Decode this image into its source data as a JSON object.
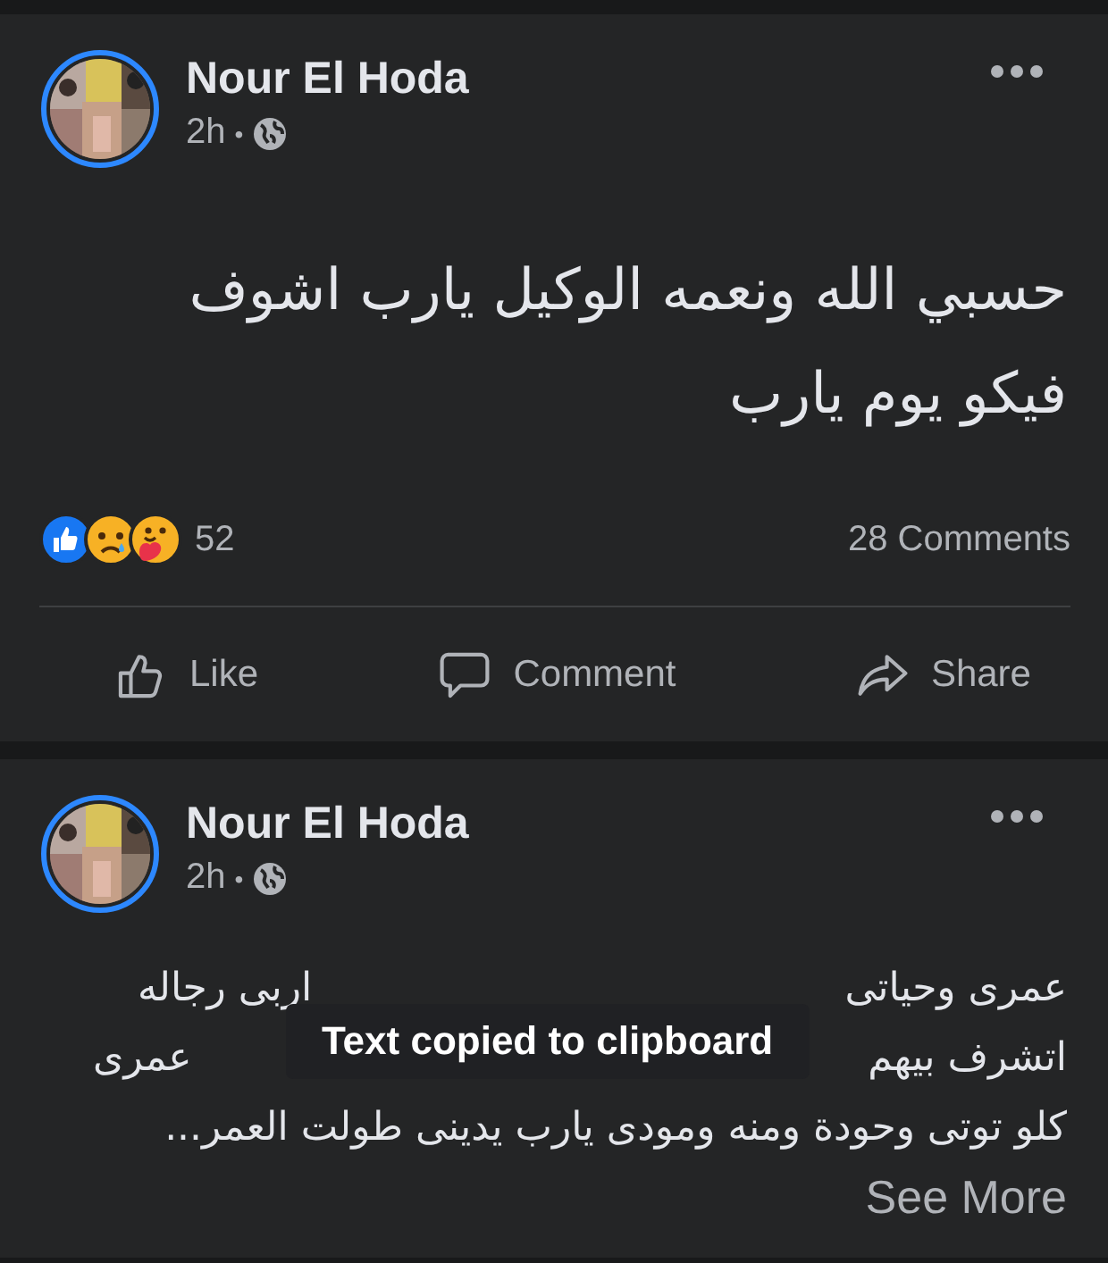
{
  "posts": [
    {
      "author": "Nour El Hoda",
      "time": "2h",
      "separator": "•",
      "avatar": {
        "kind": "picture"
      },
      "body_lines": [
        [
          "حسبي الله ونعمه الوكيل يارب اشوف"
        ],
        [
          "فيكو يوم يارب"
        ]
      ],
      "reaction_count": "52",
      "comments": "28 Comments",
      "like_button": "Like",
      "comment_button": "Comment",
      "share_button": "Share"
    },
    {
      "author": "Nour El Hoda",
      "time": "2h",
      "separator": "•",
      "avatar": {
        "kind": "picture"
      },
      "body_lines": [
        [
          "عمرى وحياتى",
          "اربى رجاله"
        ],
        [
          "اتشرف بيهم",
          "عمرى"
        ],
        [
          "كلو توتى وحودة ومنه ومودى يارب يدينى طولت العمر..."
        ]
      ],
      "see_more": "See More"
    }
  ],
  "toast": "Text copied to clipboard"
}
